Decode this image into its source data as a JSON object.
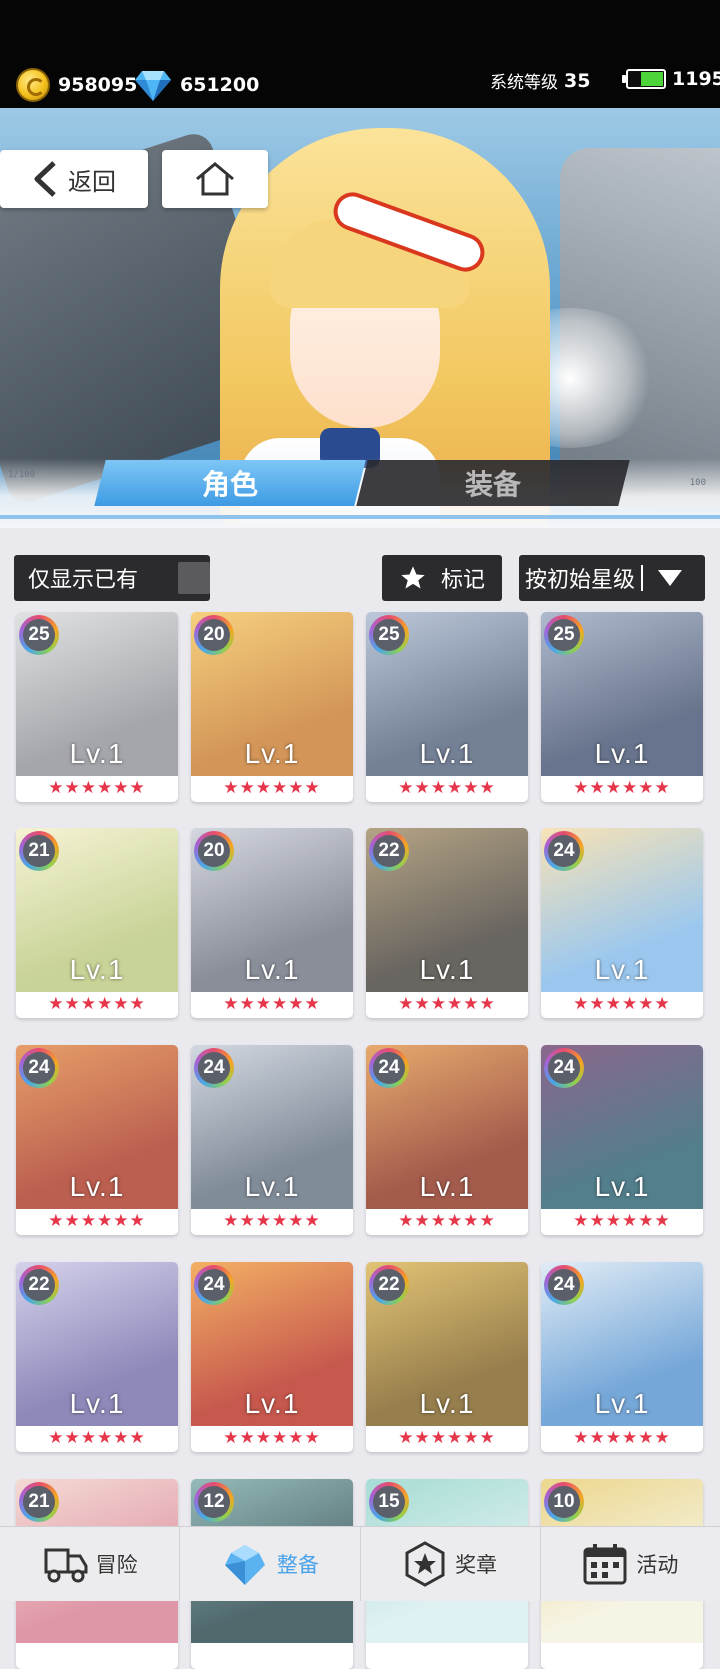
{
  "resources": {
    "gold": "958095",
    "diamond": "651200",
    "system_level_label": "系统等级",
    "system_level_value": "35",
    "energy": "1195"
  },
  "nav": {
    "back_label": "返回"
  },
  "tabs": [
    {
      "label": "角色",
      "active": true
    },
    {
      "label": "装备",
      "active": false
    }
  ],
  "banner_deco": {
    "left_1": "1/100",
    "right_1": "100"
  },
  "filters": {
    "owned_only_label": "仅显示已有",
    "mark_label": "标记",
    "sort_label": "按初始星级"
  },
  "cards": [
    {
      "badge": "25",
      "level": "Lv.1",
      "stars": "★★★★★★",
      "colors": [
        "#8c8e94",
        "#d8d9dc"
      ]
    },
    {
      "badge": "20",
      "level": "Lv.1",
      "stars": "★★★★★★",
      "colors": [
        "#c7782a",
        "#f3c35a"
      ]
    },
    {
      "badge": "25",
      "level": "Lv.1",
      "stars": "★★★★★★",
      "colors": [
        "#4d5d78",
        "#a9b8cf"
      ]
    },
    {
      "badge": "25",
      "level": "Lv.1",
      "stars": "★★★★★★",
      "colors": [
        "#3e4d6d",
        "#9aa7c0"
      ]
    },
    {
      "badge": "21",
      "level": "Lv.1",
      "stars": "★★★★★★",
      "colors": [
        "#b9c77a",
        "#f4efc9"
      ]
    },
    {
      "badge": "20",
      "level": "Lv.1",
      "stars": "★★★★★★",
      "colors": [
        "#6a6f7d",
        "#c9ccd6"
      ]
    },
    {
      "badge": "22",
      "level": "Lv.1",
      "stars": "★★★★★★",
      "colors": [
        "#3f3a34",
        "#a08a63"
      ]
    },
    {
      "badge": "24",
      "level": "Lv.1",
      "stars": "★★★★★★",
      "colors": [
        "#7fb8ea",
        "#f6dba2"
      ]
    },
    {
      "badge": "24",
      "level": "Lv.1",
      "stars": "★★★★★★",
      "colors": [
        "#a8321f",
        "#e0833f"
      ]
    },
    {
      "badge": "24",
      "level": "Lv.1",
      "stars": "★★★★★★",
      "colors": [
        "#5e6c7d",
        "#c5cdd8"
      ]
    },
    {
      "badge": "24",
      "level": "Lv.1",
      "stars": "★★★★★★",
      "colors": [
        "#8a2d1a",
        "#e09245"
      ]
    },
    {
      "badge": "24",
      "level": "Lv.1",
      "stars": "★★★★★★",
      "colors": [
        "#235a6b",
        "#6a3d6e"
      ]
    },
    {
      "badge": "22",
      "level": "Lv.1",
      "stars": "★★★★★★",
      "colors": [
        "#6d68a6",
        "#c9c4e6"
      ]
    },
    {
      "badge": "24",
      "level": "Lv.1",
      "stars": "★★★★★★",
      "colors": [
        "#b72a1c",
        "#f09a39"
      ]
    },
    {
      "badge": "22",
      "level": "Lv.1",
      "stars": "★★★★★★",
      "colors": [
        "#7a5a1b",
        "#d9b34e"
      ]
    },
    {
      "badge": "24",
      "level": "Lv.1",
      "stars": "★★★★★★",
      "colors": [
        "#4f8fce",
        "#d9e7f3"
      ]
    },
    {
      "badge": "21",
      "level": "",
      "stars": "",
      "colors": [
        "#d77a8f",
        "#f1d0c8"
      ]
    },
    {
      "badge": "12",
      "level": "",
      "stars": "",
      "colors": [
        "#1f3f45",
        "#76a6a4"
      ]
    },
    {
      "badge": "15",
      "level": "",
      "stars": "",
      "colors": [
        "#d8eef0",
        "#8fd3c8"
      ]
    },
    {
      "badge": "10",
      "level": "",
      "stars": "",
      "colors": [
        "#f4f1dd",
        "#e7cc6e"
      ]
    }
  ],
  "bottom_nav": [
    {
      "label": "冒险",
      "icon": "truck-icon",
      "active": false
    },
    {
      "label": "整备",
      "icon": "crystal-icon",
      "active": true
    },
    {
      "label": "奖章",
      "icon": "medal-icon",
      "active": false
    },
    {
      "label": "活动",
      "icon": "calendar-icon",
      "active": false
    }
  ]
}
